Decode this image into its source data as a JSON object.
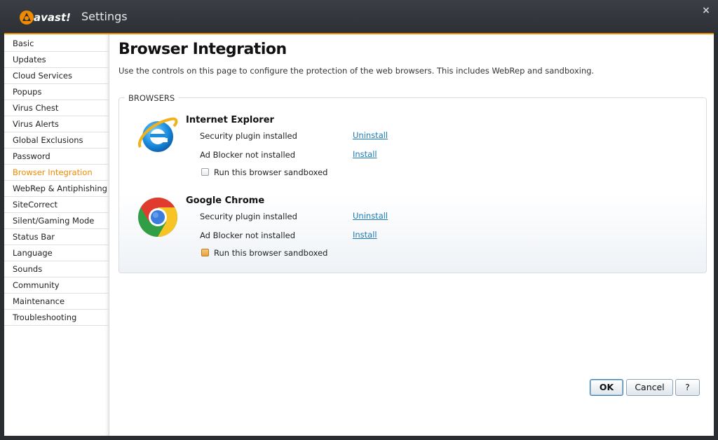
{
  "window": {
    "brand": "avast!",
    "title": "Settings",
    "close_label": "×"
  },
  "sidebar": {
    "items": [
      {
        "label": "Basic",
        "active": false
      },
      {
        "label": "Updates",
        "active": false
      },
      {
        "label": "Cloud Services",
        "active": false
      },
      {
        "label": "Popups",
        "active": false
      },
      {
        "label": "Virus Chest",
        "active": false
      },
      {
        "label": "Virus Alerts",
        "active": false
      },
      {
        "label": "Global Exclusions",
        "active": false
      },
      {
        "label": "Password",
        "active": false
      },
      {
        "label": "Browser Integration",
        "active": true
      },
      {
        "label": "WebRep & Antiphishing",
        "active": false
      },
      {
        "label": "SiteCorrect",
        "active": false
      },
      {
        "label": "Silent/Gaming Mode",
        "active": false
      },
      {
        "label": "Status Bar",
        "active": false
      },
      {
        "label": "Language",
        "active": false
      },
      {
        "label": "Sounds",
        "active": false
      },
      {
        "label": "Community",
        "active": false
      },
      {
        "label": "Maintenance",
        "active": false
      },
      {
        "label": "Troubleshooting",
        "active": false
      }
    ]
  },
  "page": {
    "title": "Browser Integration",
    "description": "Use the controls on this page to configure the protection of the web browsers. This includes WebRep and sandboxing."
  },
  "browsers_group": {
    "label": "BROWSERS",
    "browsers": [
      {
        "name": "Internet Explorer",
        "icon": "internet-explorer-icon",
        "plugin_status": "Security plugin installed",
        "plugin_action": "Uninstall",
        "adblock_status": "Ad Blocker not installed",
        "adblock_action": "Install",
        "sandbox_label": "Run this browser sandboxed",
        "sandboxed": false
      },
      {
        "name": "Google Chrome",
        "icon": "google-chrome-icon",
        "plugin_status": "Security plugin installed",
        "plugin_action": "Uninstall",
        "adblock_status": "Ad Blocker not installed",
        "adblock_action": "Install",
        "sandbox_label": "Run this browser sandboxed",
        "sandboxed": true
      }
    ]
  },
  "footer": {
    "ok_label": "OK",
    "cancel_label": "Cancel",
    "help_label": "?"
  },
  "colors": {
    "accent": "#f08a00",
    "link": "#1a7ab8",
    "titlebar": "#2c2f34"
  }
}
